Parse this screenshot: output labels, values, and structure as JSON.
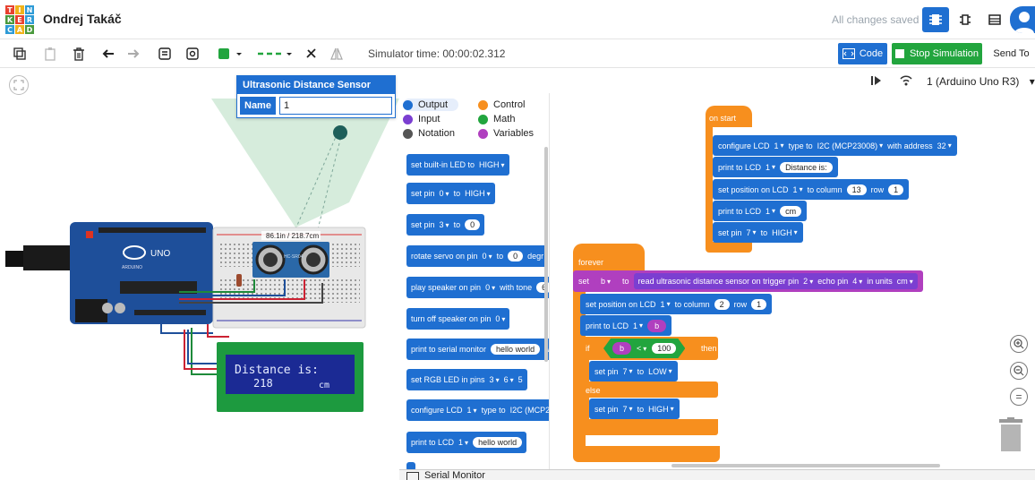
{
  "header": {
    "logo_letters": [
      "T",
      "I",
      "N",
      "K",
      "E",
      "R",
      "C",
      "A",
      "D"
    ],
    "project_name": "Ondrej Takáč",
    "save_status": "All changes saved",
    "colors": {
      "brand_blue": "#1f6fd1",
      "stop_green": "#22a53e",
      "control_orange": "#f78f1e"
    }
  },
  "toolbar": {
    "simulator_time": "Simulator time: 00:00:02.312",
    "code_label": "Code",
    "stop_label": "Stop Simulation",
    "send_label": "Send To"
  },
  "inspector": {
    "title": "Ultrasonic Distance Sensor",
    "name_label": "Name",
    "name_value": "1"
  },
  "circuit": {
    "sensor_readout": "86.1in / 218.7cm",
    "lcd_line1": "Distance is:",
    "lcd_line2": "218",
    "lcd_unit": "cm",
    "board_logo": "UNO",
    "board_brand": "ARDUINO",
    "sensor_model": "HC-SR04"
  },
  "workspace_header": {
    "device_select": "1 (Arduino Uno R3)"
  },
  "palette": {
    "categories": [
      {
        "label": "Output",
        "color": "#1f6fd1"
      },
      {
        "label": "Control",
        "color": "#f78f1e"
      },
      {
        "label": "Input",
        "color": "#7b3fd1"
      },
      {
        "label": "Math",
        "color": "#22a53e"
      },
      {
        "label": "Notation",
        "color": "#555555"
      },
      {
        "label": "Variables",
        "color": "#b03fbf"
      }
    ],
    "blocks": {
      "b1": [
        "set built-in LED to",
        "HIGH"
      ],
      "b2": [
        "set pin",
        "0",
        "to",
        "HIGH"
      ],
      "b3": [
        "set pin",
        "3",
        "to",
        "0"
      ],
      "b4": [
        "rotate servo on pin",
        "0",
        "to",
        "0",
        "degr"
      ],
      "b5": [
        "play speaker on pin",
        "0",
        "with tone",
        "6"
      ],
      "b6": [
        "turn off speaker on pin",
        "0"
      ],
      "b7": [
        "print to serial monitor",
        "hello world",
        "with"
      ],
      "b8": [
        "set RGB LED in pins",
        "3",
        "6",
        "5"
      ],
      "b9": [
        "configure LCD",
        "1",
        "type to",
        "I2C (MCP2"
      ],
      "b10": [
        "print to LCD",
        "1",
        "hello world"
      ]
    }
  },
  "script": {
    "on_start": {
      "label": "on start",
      "s1": [
        "configure LCD",
        "1",
        "type to",
        "I2C (MCP23008)",
        "with address",
        "32"
      ],
      "s2": [
        "print to LCD",
        "1",
        "Distance is:"
      ],
      "s3": [
        "set position on LCD",
        "1",
        "to column",
        "13",
        "row",
        "1"
      ],
      "s4": [
        "print to LCD",
        "1",
        "cm"
      ],
      "s5": [
        "set pin",
        "7",
        "to",
        "HIGH"
      ]
    },
    "forever": {
      "label": "forever",
      "f1": [
        "set",
        "b",
        "to",
        "read ultrasonic distance sensor on trigger pin",
        "2",
        "echo pin",
        "4",
        "in units",
        "cm"
      ],
      "f2": [
        "set position on LCD",
        "1",
        "to column",
        "2",
        "row",
        "1"
      ],
      "f3": [
        "print to LCD",
        "1",
        "b"
      ],
      "if_label": "if",
      "cond_var": "b",
      "cond_op": "<",
      "cond_val": "100",
      "then_label": "then",
      "f4": [
        "set pin",
        "7",
        "to",
        "LOW"
      ],
      "else_label": "else",
      "f5": [
        "set pin",
        "7",
        "to",
        "HIGH"
      ]
    }
  },
  "zoom": {
    "zoom_in": "+",
    "zoom_out": "−",
    "reset": "="
  },
  "serial_monitor": {
    "label": "Serial Monitor"
  }
}
